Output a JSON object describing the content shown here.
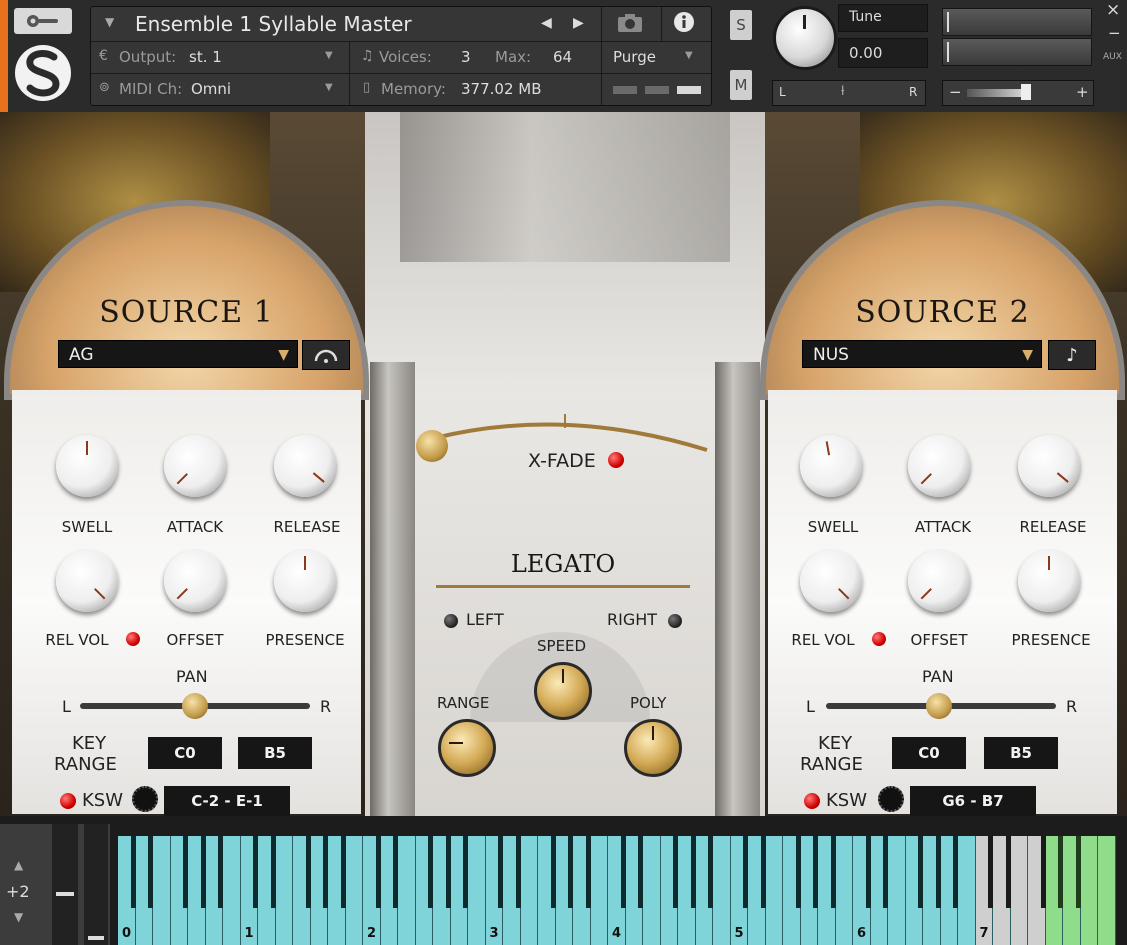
{
  "header": {
    "instrument_name": "Ensemble 1 Syllable Master",
    "output_label": "Output:",
    "output_value": "st. 1",
    "voices_label": "Voices:",
    "voices_value": "3",
    "max_label": "Max:",
    "max_value": "64",
    "purge_label": "Purge",
    "midi_label": "MIDI Ch:",
    "midi_value": "Omni",
    "memory_label": "Memory:",
    "memory_value": "377.02 MB",
    "solo_label": "S",
    "mute_label": "M",
    "tune_label": "Tune",
    "tune_value": "0.00",
    "pan_left": "L",
    "pan_right": "R",
    "vol_minus": "−",
    "vol_plus": "+",
    "close_glyph": "×",
    "minimize_glyph": "−",
    "aux_label": "AUX"
  },
  "source1": {
    "title": "SOURCE 1",
    "preset": "AG",
    "knobs": {
      "swell": "SWELL",
      "attack": "ATTACK",
      "release": "RELEASE",
      "rel_vol": "REL VOL",
      "offset": "OFFSET",
      "presence": "PRESENCE"
    },
    "pan_label": "PAN",
    "pan_l": "L",
    "pan_r": "R",
    "key_range_label_1": "KEY",
    "key_range_label_2": "RANGE",
    "key_low": "C0",
    "key_high": "B5",
    "ksw_label": "KSW",
    "ksw_range": "C-2 - E-1"
  },
  "source2": {
    "title": "SOURCE 2",
    "preset": "NUS",
    "knobs": {
      "swell": "SWELL",
      "attack": "ATTACK",
      "release": "RELEASE",
      "rel_vol": "REL VOL",
      "offset": "OFFSET",
      "presence": "PRESENCE"
    },
    "pan_label": "PAN",
    "pan_l": "L",
    "pan_r": "R",
    "key_range_label_1": "KEY",
    "key_range_label_2": "RANGE",
    "key_low": "C0",
    "key_high": "B5",
    "ksw_label": "KSW",
    "ksw_range": "G6 - B7"
  },
  "center": {
    "xfade_label": "X-FADE",
    "legato_title": "LEGATO",
    "left_label": "LEFT",
    "right_label": "RIGHT",
    "speed_label": "SPEED",
    "range_label": "RANGE",
    "poly_label": "POLY"
  },
  "keyboard": {
    "octave_shift": "+2",
    "octave_labels": [
      "0",
      "1",
      "2",
      "3",
      "4",
      "5",
      "6",
      "7"
    ]
  }
}
